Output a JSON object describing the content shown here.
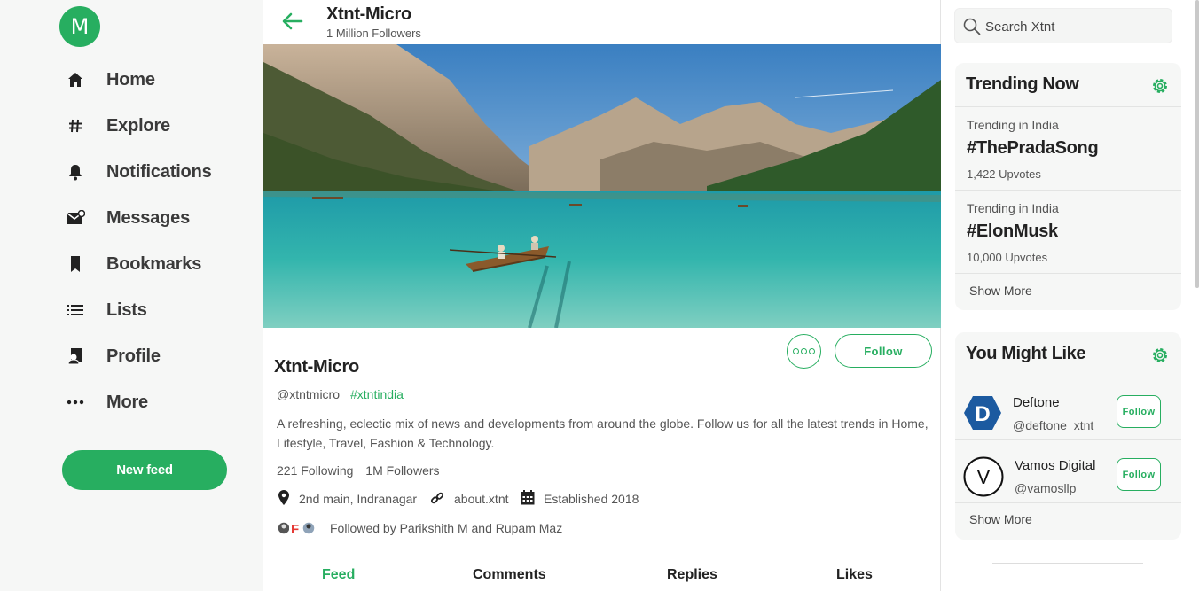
{
  "app": {
    "logo_letter": "M",
    "accent_color": "#27ae60"
  },
  "sidebar": {
    "items": [
      {
        "label": "Home",
        "icon": "home-icon"
      },
      {
        "label": "Explore",
        "icon": "hash-icon"
      },
      {
        "label": "Notifications",
        "icon": "bell-icon"
      },
      {
        "label": "Messages",
        "icon": "envelope-icon"
      },
      {
        "label": "Bookmarks",
        "icon": "bookmark-icon"
      },
      {
        "label": "Lists",
        "icon": "list-icon"
      },
      {
        "label": "Profile",
        "icon": "profile-icon"
      },
      {
        "label": "More",
        "icon": "more-icon"
      }
    ],
    "new_feed_label": "New feed"
  },
  "header": {
    "name": "Xtnt-Micro",
    "followers_line": "1 Million Followers"
  },
  "profile": {
    "name": "Xtnt-Micro",
    "handle": "@xtntmicro",
    "tag": "#xtntindia",
    "bio": "A refreshing, eclectic mix of news and developments from around the globe. Follow us for all the latest trends in Home, Lifestyle, Travel, Fashion & Technology.",
    "following": "221 Following",
    "followers": "1M Followers",
    "location": "2nd main, Indranagar",
    "website": "about.xtnt",
    "established": "Established 2018",
    "followed_by": "Followed by Parikshith M and Rupam Maz",
    "follow_label": "Follow"
  },
  "tabs": [
    {
      "label": "Feed",
      "active": true
    },
    {
      "label": "Comments",
      "active": false
    },
    {
      "label": "Replies",
      "active": false
    },
    {
      "label": "Likes",
      "active": false
    }
  ],
  "search": {
    "placeholder": "Search Xtnt"
  },
  "trending": {
    "title": "Trending Now",
    "items": [
      {
        "context": "Trending in India",
        "tag": "#ThePradaSong",
        "votes": "1,422 Upvotes"
      },
      {
        "context": "Trending in India",
        "tag": "#ElonMusk",
        "votes": "10,000 Upvotes"
      }
    ],
    "show_more": "Show More"
  },
  "suggestions": {
    "title": "You Might Like",
    "items": [
      {
        "name": "Deftone",
        "handle": "@deftone_xtnt",
        "avatar_letter": "D",
        "follow_label": "Follow"
      },
      {
        "name": "Vamos Digital",
        "handle": "@vamosllp",
        "avatar_letter": "V",
        "follow_label": "Follow"
      }
    ],
    "show_more": "Show More"
  }
}
